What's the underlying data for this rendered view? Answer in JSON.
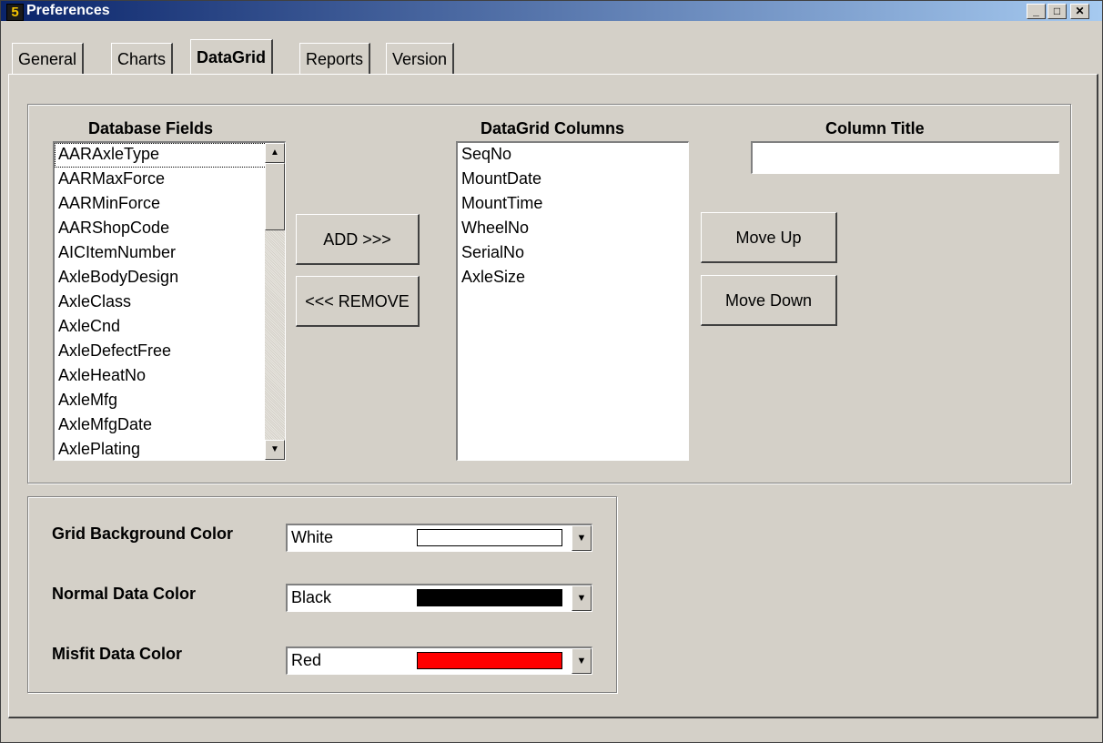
{
  "window": {
    "title": "Preferences",
    "icon_text": "5",
    "buttons": {
      "minimize": "_",
      "maximize": "□",
      "close": "✕"
    }
  },
  "tabs": [
    {
      "label": "General"
    },
    {
      "label": "Charts"
    },
    {
      "label": "DataGrid",
      "active": true
    },
    {
      "label": "Reports"
    },
    {
      "label": "Version"
    }
  ],
  "fields": {
    "database_fields_label": "Database Fields",
    "datagrid_columns_label": "DataGrid Columns",
    "column_title_label": "Column Title",
    "column_title_value": "",
    "database_fields": [
      "AARAxleType",
      "AARMaxForce",
      "AARMinForce",
      "AARShopCode",
      "AICItemNumber",
      "AxleBodyDesign",
      "AxleClass",
      "AxleCnd",
      "AxleDefectFree",
      "AxleHeatNo",
      "AxleMfg",
      "AxleMfgDate",
      "AxlePlating"
    ],
    "datagrid_columns": [
      "SeqNo",
      "MountDate",
      "MountTime",
      "WheelNo",
      "SerialNo",
      "AxleSize"
    ],
    "add_label": "ADD >>>",
    "remove_label": "<<< REMOVE",
    "move_up_label": "Move Up",
    "move_down_label": "Move Down",
    "scroll_up_icon": "▲",
    "scroll_down_icon": "▼"
  },
  "colors": {
    "grid_bg_label": "Grid Background Color",
    "grid_bg_value": "White",
    "grid_bg_hex": "#ffffff",
    "normal_label": "Normal Data Color",
    "normal_value": "Black",
    "normal_hex": "#000000",
    "misfit_label": "Misfit Data Color",
    "misfit_value": "Red",
    "misfit_hex": "#ff0000",
    "dropdown_icon": "▼"
  }
}
